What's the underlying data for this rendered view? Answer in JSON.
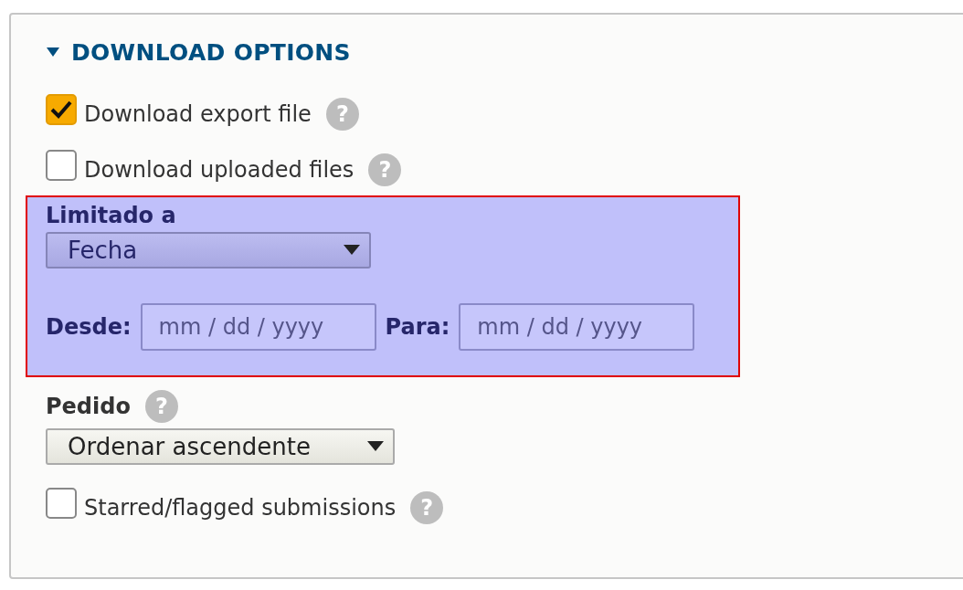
{
  "section": {
    "title": "DOWNLOAD OPTIONS",
    "expanded": true
  },
  "options": [
    {
      "label": "Download export file",
      "checked": true,
      "help": "?"
    },
    {
      "label": "Download uploaded files",
      "checked": false,
      "help": "?"
    }
  ],
  "limit": {
    "highlighted": true,
    "label": "Limitado a",
    "select": "Fecha",
    "from_label": "Desde:",
    "from": {
      "placeholder": "mm / dd / yyyy"
    },
    "to_label": "Para:",
    "to": {
      "placeholder": "mm / dd / yyyy"
    }
  },
  "order": {
    "label": "Pedido",
    "help": "?",
    "select": "Ordenar ascendente"
  },
  "starred": {
    "label": "Starred/flagged submissions",
    "checked": false,
    "help": "?"
  }
}
